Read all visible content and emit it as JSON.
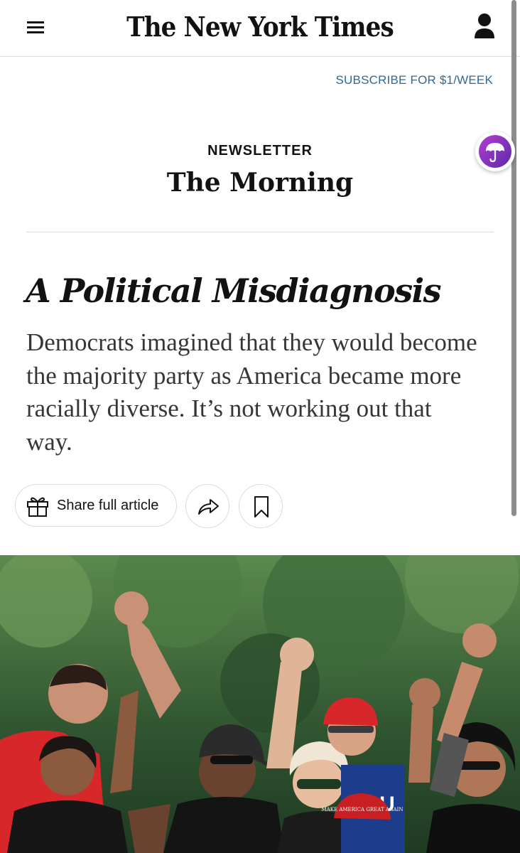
{
  "header": {
    "masthead": "The New York Times"
  },
  "subscribe_label": "SUBSCRIBE FOR $1/WEEK",
  "newsletter": {
    "kicker": "NEWSLETTER",
    "column": "The Morning"
  },
  "article": {
    "headline": "A Political Misdiagnosis",
    "summary": "Democrats imagined that they would become the majority party as America became more racially diverse. It’s not working out that way."
  },
  "actions": {
    "share_label": "Share full article"
  },
  "icons": {
    "menu": "hamburger-menu-icon",
    "account": "user-account-icon",
    "badge": "umbrella-icon",
    "gift": "gift-icon",
    "share": "share-arrow-icon",
    "save": "bookmark-icon"
  },
  "colors": {
    "link": "#326891",
    "text": "#121212",
    "summary": "#363636",
    "badge": "#8a33c4"
  },
  "photo": {
    "sign_text": "MAKE AMERICA GREAT AGAIN"
  }
}
